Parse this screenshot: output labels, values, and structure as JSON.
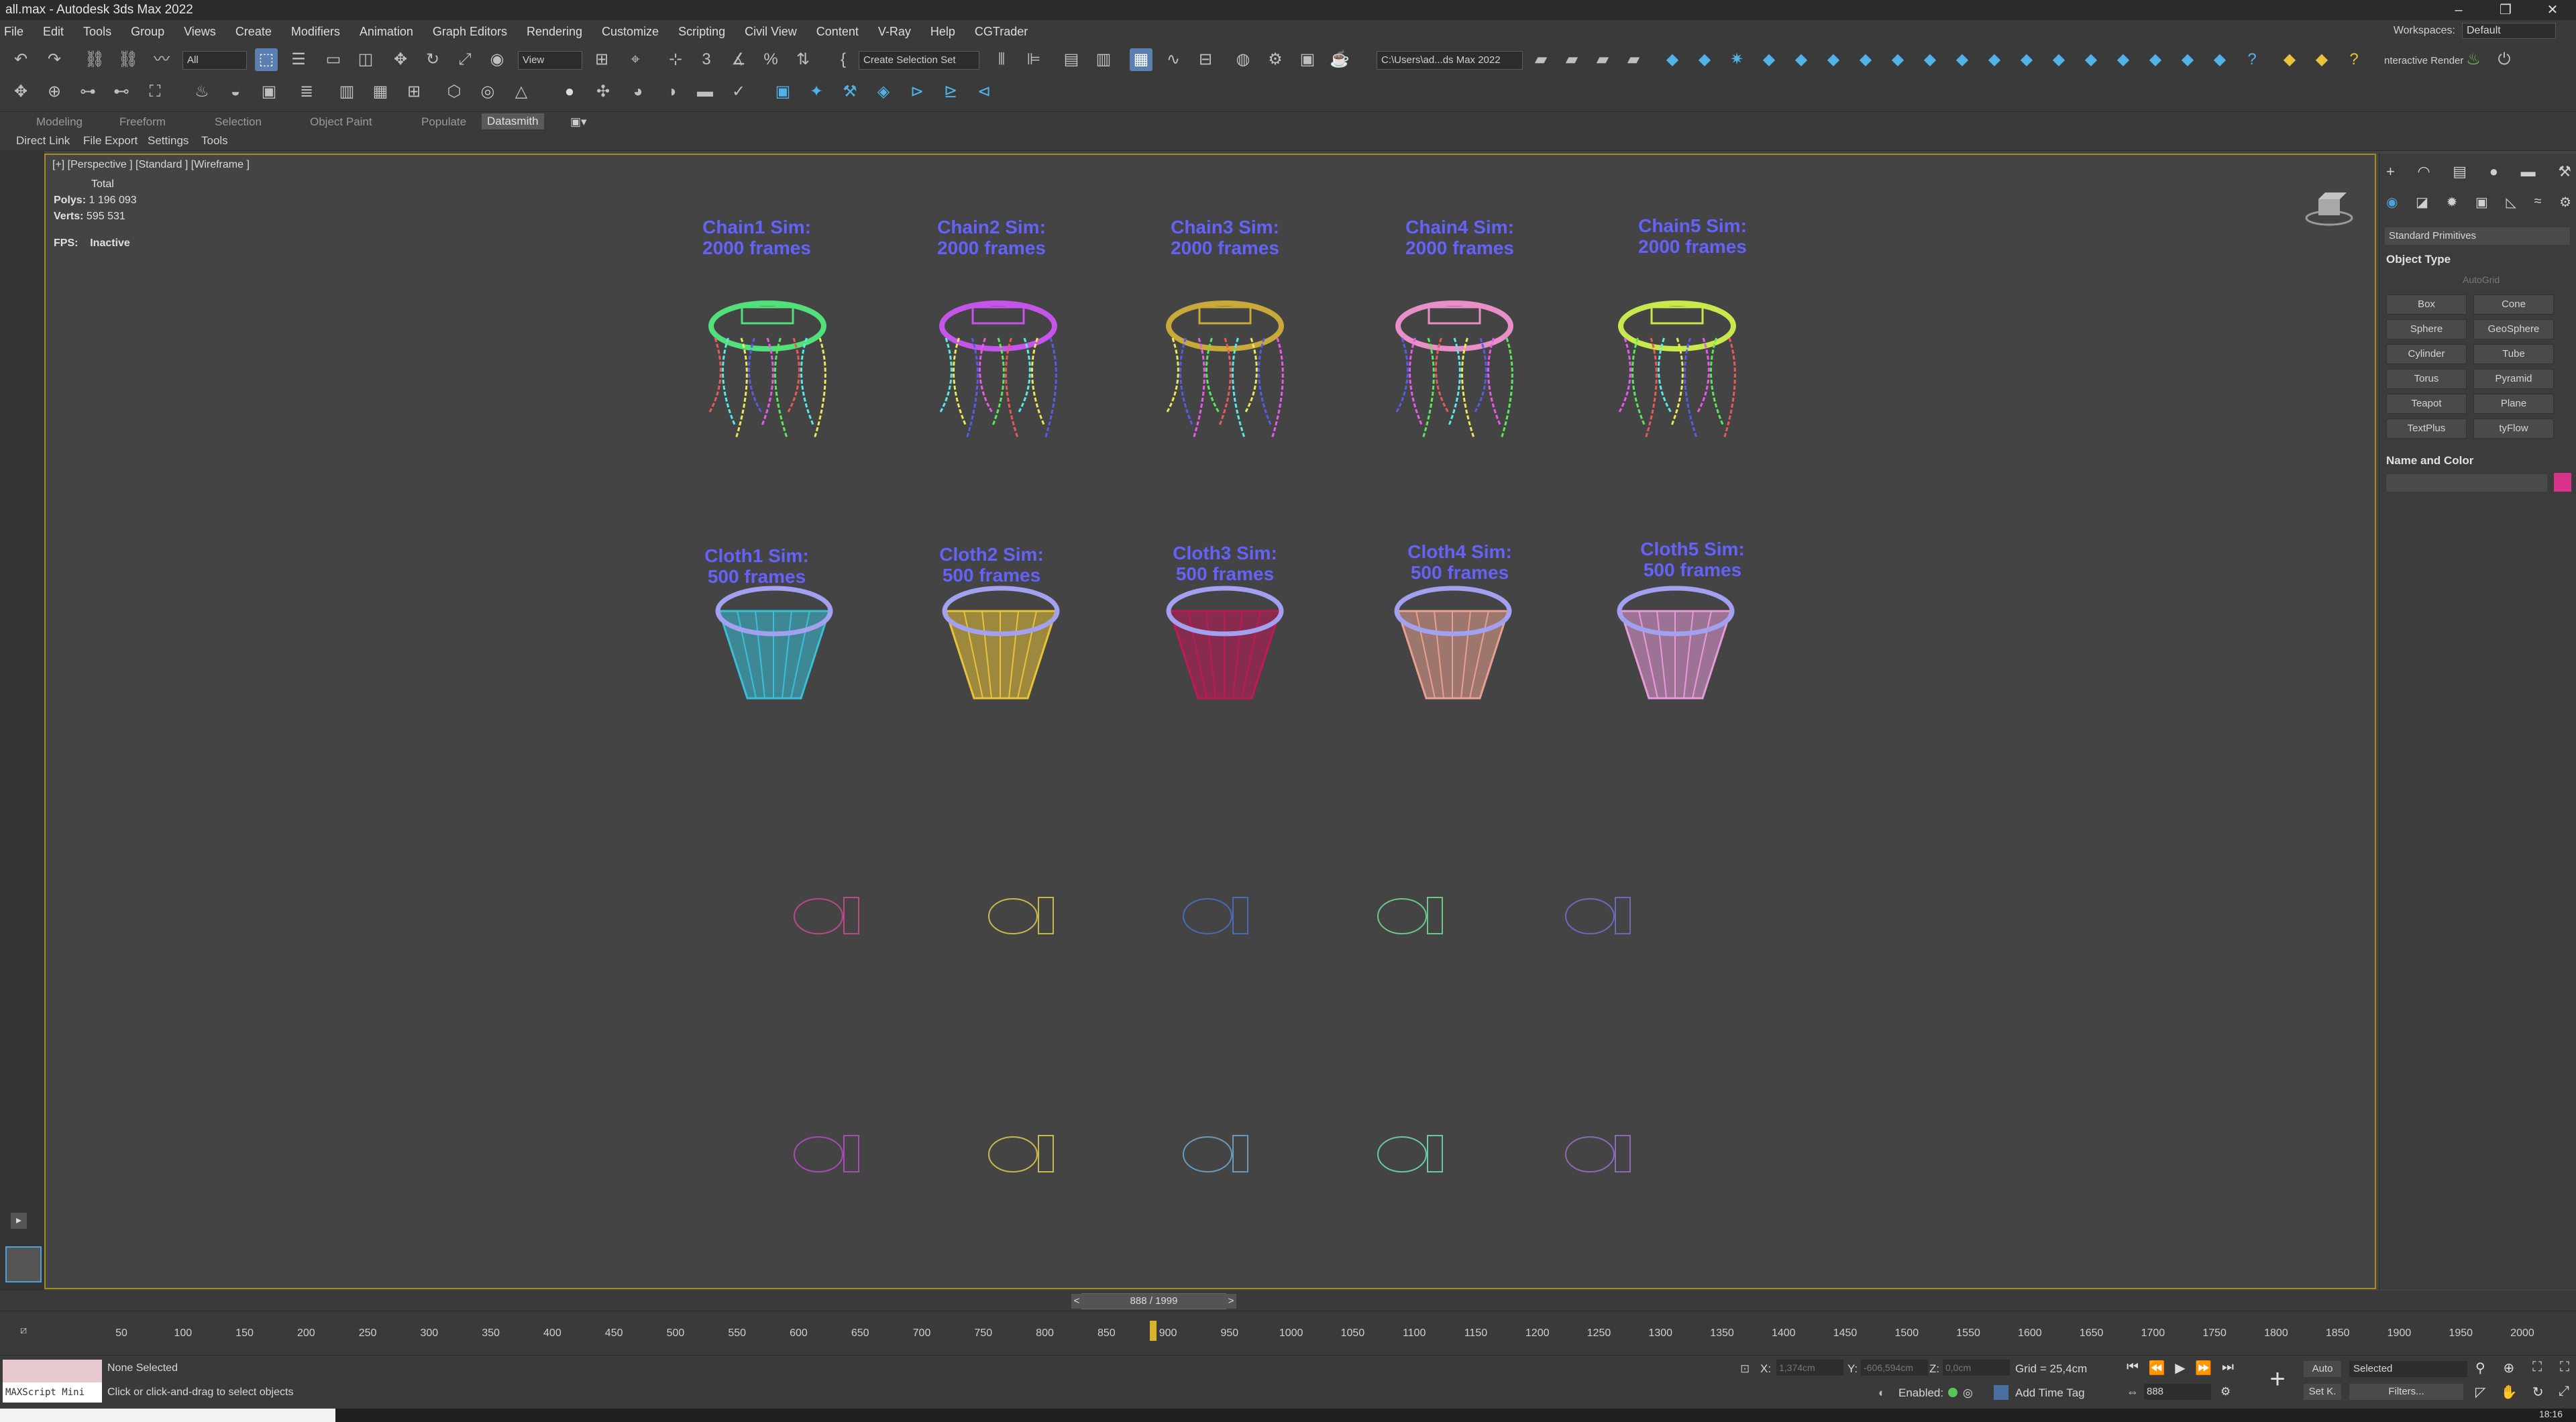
{
  "window": {
    "title": "all.max - Autodesk 3ds Max 2022",
    "controls": [
      "–",
      "❐",
      "✕"
    ]
  },
  "menubar": {
    "items": [
      "File",
      "Edit",
      "Tools",
      "Group",
      "Views",
      "Create",
      "Modifiers",
      "Animation",
      "Graph Editors",
      "Rendering",
      "Customize",
      "Scripting",
      "Civil View",
      "Content",
      "V-Ray",
      "Help",
      "CGTrader"
    ],
    "workspaces_label": "Workspaces:",
    "workspaces_value": "Default"
  },
  "toolbar": {
    "selection_filter": "All",
    "ref_coord": "View",
    "selection_set_placeholder": "Create Selection Set",
    "project_path": "C:\\Users\\ad...ds Max 2022",
    "interactive_render": "nteractive Render"
  },
  "ribbon": {
    "tabs": [
      "Modeling",
      "Freeform",
      "Selection",
      "Object Paint",
      "Populate",
      "Datasmith"
    ],
    "active_tab": "Datasmith",
    "subtabs": [
      "Direct Link",
      "File Export",
      "Settings",
      "Tools"
    ]
  },
  "viewport": {
    "label": "[+] [Perspective ] [Standard ] [Wireframe ]",
    "stats": {
      "total_label": "Total",
      "polys_label": "Polys:",
      "polys_value": "1 196 093",
      "verts_label": "Verts:",
      "verts_value": "595 531",
      "fps_label": "FPS:",
      "fps_value": "Inactive"
    },
    "chain_labels": [
      {
        "line1": "Chain1 Sim:",
        "line2": "2000 frames"
      },
      {
        "line1": "Chain2 Sim:",
        "line2": "2000 frames"
      },
      {
        "line1": "Chain3 Sim:",
        "line2": "2000 frames"
      },
      {
        "line1": "Chain4 Sim:",
        "line2": "2000 frames"
      },
      {
        "line1": "Chain5 Sim:",
        "line2": "2000 frames"
      }
    ],
    "cloth_labels": [
      {
        "line1": "Cloth1 Sim:",
        "line2": "500 frames"
      },
      {
        "line1": "Cloth2 Sim:",
        "line2": "500 frames"
      },
      {
        "line1": "Cloth3 Sim:",
        "line2": "500 frames"
      },
      {
        "line1": "Cloth4 Sim:",
        "line2": "500 frames"
      },
      {
        "line1": "Cloth5 Sim:",
        "line2": "500 frames"
      }
    ],
    "chain_colors": [
      "#52e07a",
      "#c455e8",
      "#c8a93a",
      "#e88fc8",
      "#c8e84e"
    ],
    "cloth_colors": [
      "#3bbfd8",
      "#e8c23a",
      "#c0195a",
      "#e8a090",
      "#e89ad8"
    ]
  },
  "command_panel": {
    "dropdown": "Standard Primitives",
    "object_type_title": "Object Type",
    "autogrid": "AutoGrid",
    "buttons": [
      "Box",
      "Cone",
      "Sphere",
      "GeoSphere",
      "Cylinder",
      "Tube",
      "Torus",
      "Pyramid",
      "Teapot",
      "Plane",
      "TextPlus",
      "tyFlow"
    ],
    "name_color_title": "Name and Color",
    "object_color": "#d8328a"
  },
  "timeline": {
    "frame_indicator": "888 / 1999",
    "prev": "<",
    "next": ">",
    "ticks": [
      "50",
      "100",
      "150",
      "200",
      "250",
      "300",
      "350",
      "400",
      "450",
      "500",
      "550",
      "600",
      "650",
      "700",
      "750",
      "800",
      "850",
      "900",
      "950",
      "1000",
      "1050",
      "1100",
      "1150",
      "1200",
      "1250",
      "1300",
      "1350",
      "1400",
      "1450",
      "1500",
      "1550",
      "1600",
      "1650",
      "1700",
      "1750",
      "1800",
      "1850",
      "1900",
      "1950",
      "2000"
    ],
    "current_frame": 888,
    "total_frames": 2000
  },
  "status": {
    "maxscript": "MAXScript Mini",
    "selection": "None Selected",
    "prompt": "Click or click-and-drag to select objects",
    "x_label": "X:",
    "x_value": "1,374cm",
    "y_label": "Y:",
    "y_value": "-606,594cm",
    "z_label": "Z:",
    "z_value": "0,0cm",
    "grid": "Grid = 25,4cm",
    "enabled_label": "Enabled:",
    "add_time_tag": "Add Time Tag",
    "auto": "Auto",
    "selected_dropdown": "Selected",
    "set_key": "Set K.",
    "filters": "Filters...",
    "frame_field": "888",
    "clock": "18:16"
  }
}
